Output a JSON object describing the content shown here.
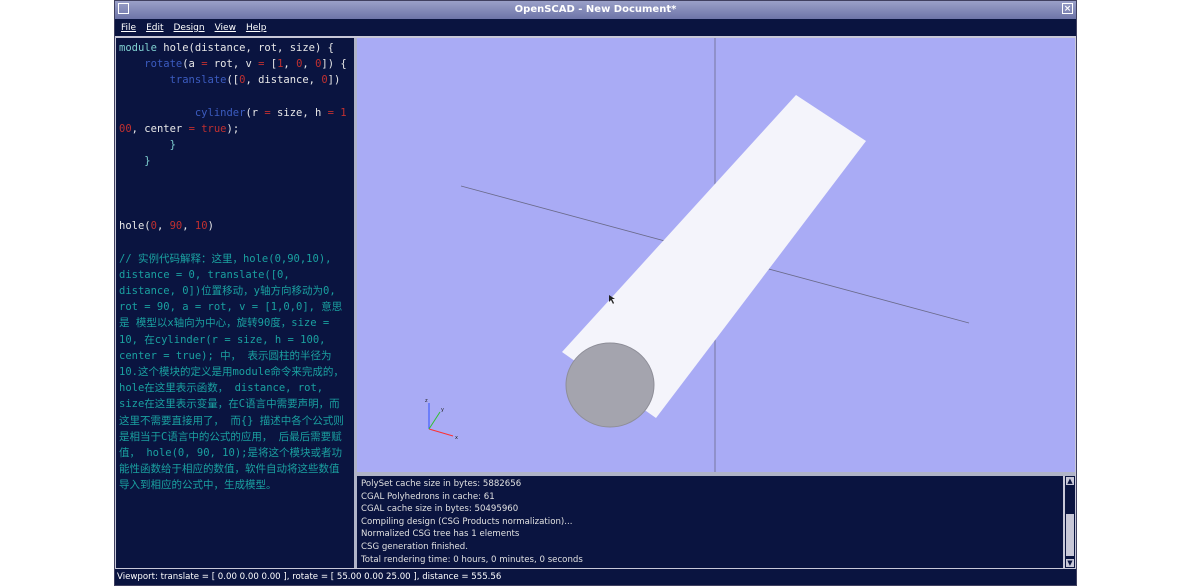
{
  "window": {
    "title": "OpenSCAD - New Document*"
  },
  "menu": {
    "items": [
      "File",
      "Edit",
      "Design",
      "View",
      "Help"
    ]
  },
  "editor": {
    "code": {
      "l1_kw": "module",
      "l1_rest": " hole(distance, rot, size) {",
      "l2_fn": "rotate",
      "l2_a": "(a ",
      "l2_eq": "=",
      "l2_b": " rot, v ",
      "l2_eq2": "=",
      "l2_c": " [",
      "l2_n1": "1",
      "l2_d": ", ",
      "l2_n2": "0",
      "l2_e": ", ",
      "l2_n3": "0",
      "l2_f": "]) {",
      "l3_fn": "translate",
      "l3_a": "([",
      "l3_n1": "0",
      "l3_b": ", distance, ",
      "l3_n2": "0",
      "l3_c": "])",
      "l5_fn": "cylinder",
      "l5_a": "(r ",
      "l5_eq": "=",
      "l5_b": " size, h ",
      "l5_eq2": "=",
      "l5_n": " 1",
      "l6_n": "00",
      "l6_a": ", center ",
      "l6_eq": "=",
      "l6_bool": " true",
      "l6_b": ");",
      "l7": "}",
      "l8": "}",
      "call_fn": "hole",
      "call_a": "(",
      "call_n1": "0",
      "call_b": ", ",
      "call_n2": "90",
      "call_c": ", ",
      "call_n3": "10",
      "call_d": ")",
      "comment": "// 实例代码解释：这里，hole(0,90,10), distance = 0, translate([0, distance, 0])位置移动，y轴方向移动为0, rot = 90, a = rot, v = [1,0,0], 意思是 模型以x轴向为中心，旋转90度，size = 10, 在cylinder(r = size, h = 100, center = true); 中， 表示圆柱的半径为10.这个模块的定义是用module命令来完成的，hole在这里表示函数， distance, rot, size在这里表示变量，在C语言中需要声明，而这里不需要直接用了， 而{} 描述中各个公式则是相当于C语言中的公式的应用， 后最后需要赋值， hole(0, 90, 10);是将这个模块或者功能性函数给于相应的数值，软件自动将这些数值导入到相应的公式中，生成模型。"
    }
  },
  "viewport": {
    "background": "#a9abf5",
    "axis_labels": {
      "x": "x",
      "y": "y",
      "z": "z"
    }
  },
  "console": {
    "lines": [
      "PolySet cache size in bytes: 5882656",
      "CGAL Polyhedrons in cache: 61",
      "CGAL cache size in bytes: 50495960",
      "Compiling design (CSG Products normalization)...",
      "Normalized CSG tree has 1 elements",
      "CSG generation finished.",
      "Total rendering time: 0 hours, 0 minutes, 0 seconds"
    ]
  },
  "status": {
    "text": "Viewport: translate = [ 0.00 0.00 0.00 ], rotate = [ 55.00 0.00 25.00 ], distance = 555.56"
  }
}
